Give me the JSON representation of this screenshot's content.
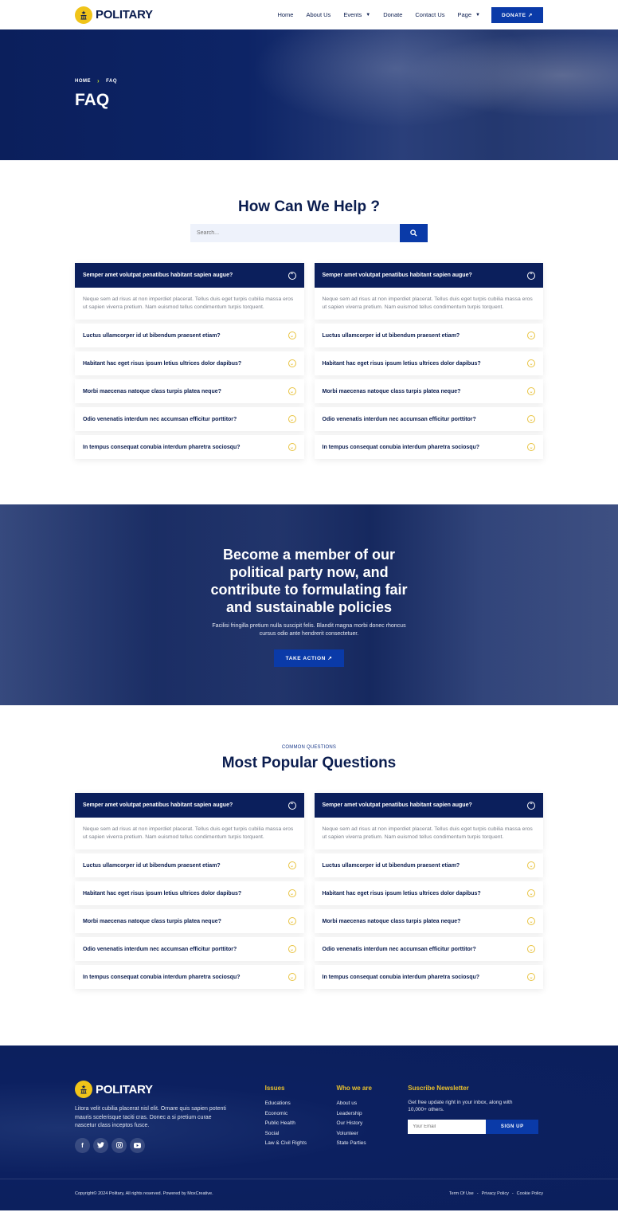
{
  "header": {
    "brand": "POLITARY",
    "nav": [
      {
        "label": "Home",
        "dropdown": false
      },
      {
        "label": "About Us",
        "dropdown": false
      },
      {
        "label": "Events",
        "dropdown": true
      },
      {
        "label": "Donate",
        "dropdown": false
      },
      {
        "label": "Contact Us",
        "dropdown": false
      },
      {
        "label": "Page",
        "dropdown": true
      }
    ],
    "donate_label": "DONATE ↗"
  },
  "hero": {
    "breadcrumb": [
      "HOME",
      "FAQ"
    ],
    "title": "FAQ"
  },
  "help": {
    "title": "How Can We Help ?",
    "search_placeholder": "Search..."
  },
  "faq": {
    "open_question": "Semper amet volutpat penatibus habitant sapien augue?",
    "open_answer": "Neque sem ad risus at non imperdiet placerat. Tellus duis eget turpis cubilia massa eros ut sapien viverra pretium. Nam euismod tellus condimentum turpis torquent.",
    "questions": [
      "Luctus ullamcorper id ut bibendum praesent etiam?",
      "Habitant hac eget risus ipsum letius ultrices dolor dapibus?",
      "Morbi maecenas natoque class turpis platea neque?",
      "Odio venenatis interdum nec accumsan efficitur porttitor?",
      "In tempus consequat conubia interdum pharetra sociosqu?"
    ]
  },
  "cta": {
    "title": "Become a member of our political party now, and contribute to formulating fair and sustainable policies",
    "text": "Facilisi fringilla pretium nulla suscipit felis. Blandit magna morbi donec rhoncus cursus odio ante hendrerit consectetuer.",
    "button": "TAKE ACTION ↗"
  },
  "popular": {
    "eyebrow": "COMMON QUESTIONS",
    "title": "Most Popular Questions"
  },
  "footer": {
    "brand": "POLITARY",
    "description": "Litora velit cubilia placerat nisl elit. Ornare quis sapien potenti mauris scelerisque taciti cras. Donec a si pretium curae nascetur class inceptos fusce.",
    "socials": [
      "facebook",
      "twitter",
      "instagram",
      "youtube"
    ],
    "issues": {
      "title": "Issues",
      "links": [
        "Educations",
        "Economic",
        "Public Health",
        "Social",
        "Law & Civil Rights"
      ]
    },
    "who": {
      "title": "Who we are",
      "links": [
        "About us",
        "Leadership",
        "Our History",
        "Volunteer",
        "State Parties"
      ]
    },
    "newsletter": {
      "title": "Suscribe Newsletter",
      "text": "Get free update right in your inbox, along with 10,000+ others.",
      "placeholder": "Your Email",
      "button": "SIGN UP"
    },
    "copyright": "Copyright© 2024 Politary, All rights reserved. Powered by MoxCreative.",
    "legal": [
      "Term Of Use",
      "Privacy Policy",
      "Cookie Policy"
    ],
    "legal_sep": "-"
  }
}
